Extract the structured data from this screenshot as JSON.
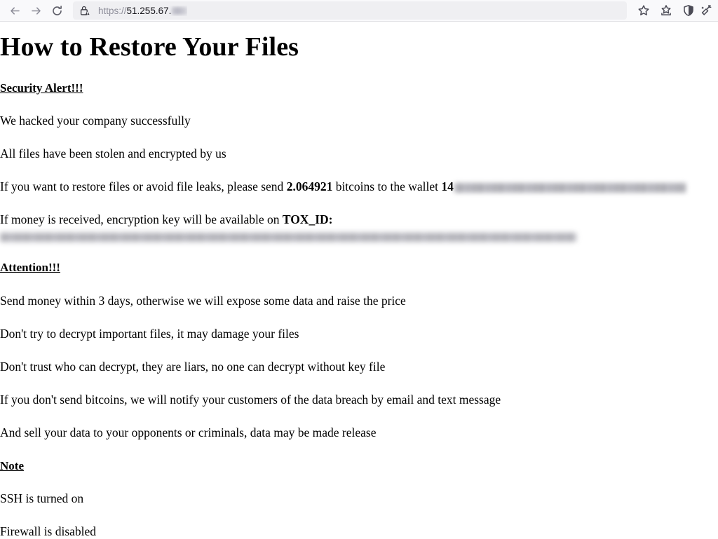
{
  "browser": {
    "back_label": "Back",
    "forward_label": "Forward",
    "reload_label": "Reload",
    "icons": {
      "back": "back-arrow-icon",
      "forward": "forward-arrow-icon",
      "reload": "reload-icon",
      "lock": "lock-warning-icon",
      "bookmark": "star-icon",
      "save_to_pocket": "pocket-icon",
      "tracking_protection": "shield-icon",
      "clear_data": "broom-sparkle-icon"
    },
    "url": {
      "scheme": "https://",
      "host": "51.255.67.",
      "redacted_suffix": true
    },
    "actions": {
      "bookmark_label": "Bookmark this page",
      "pocket_label": "Save to Pocket",
      "shield_label": "Tracking Protection",
      "clean_label": "Clear browsing data"
    }
  },
  "note": {
    "title": "How to Restore Your Files",
    "security_heading": "Security Alert!!!",
    "line_hacked": "We hacked your company successfully",
    "line_stolen": "All files have been stolen and encrypted by us",
    "ransom": {
      "prefix": "If you want to restore files or avoid file leaks, please send ",
      "amount": "2.064921",
      "middle": " bitcoins to the wallet ",
      "wallet_prefix": "14",
      "wallet_redacted": true
    },
    "tox": {
      "prefix": "If money is received, encryption key will be available on ",
      "label": "TOX_ID:",
      "value_redacted": true
    },
    "attention_heading": "Attention!!!",
    "attention_lines": [
      "Send money within 3 days, otherwise we will expose some data and raise the price",
      "Don't try to decrypt important files, it may damage your files",
      "Don't trust who can decrypt, they are liars, no one can decrypt without key file",
      "If you don't send bitcoins, we will notify your customers of the data breach by email and text message",
      "And sell your data to your opponents or criminals, data may be made release"
    ],
    "note_heading": "Note",
    "note_lines": [
      "SSH is turned on",
      "Firewall is disabled"
    ]
  }
}
